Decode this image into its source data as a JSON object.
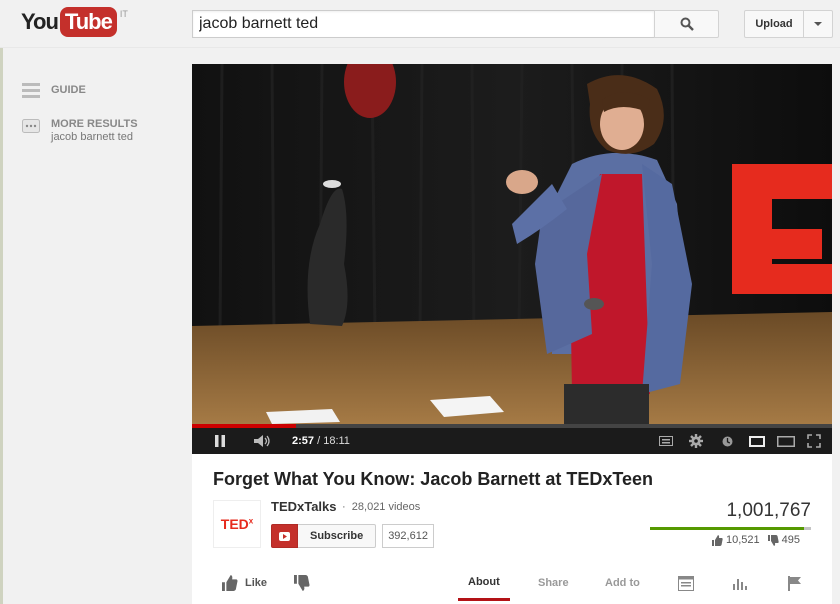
{
  "header": {
    "logo_you": "You",
    "logo_tube": "Tube",
    "region": "IT",
    "search_value": "jacob barnett ted",
    "upload_label": "Upload"
  },
  "guide": {
    "guide_label": "GUIDE",
    "more_results_label": "MORE RESULTS",
    "more_results_query": "jacob barnett ted"
  },
  "player": {
    "current_time": "2:57",
    "duration": "18:11",
    "progress_fraction": 0.162,
    "stage_letters": "TEE"
  },
  "video": {
    "title": "Forget What You Know: Jacob Barnett at TEDxTeen",
    "channel_name": "TEDxTalks",
    "video_count": "28,021 videos",
    "channel_logo": "TED",
    "channel_logo_sup": "x",
    "subscribe_label": "Subscribe",
    "subscriber_count": "392,612",
    "views": "1,001,767",
    "likes": "10,521",
    "dislikes": "495",
    "like_fraction": 0.955
  },
  "actions": {
    "like_label": "Like",
    "tabs": [
      "About",
      "Share",
      "Add to"
    ],
    "active_tab": "About"
  },
  "colors": {
    "brand_red": "#c4302b",
    "progress_red": "#cc0000",
    "like_green": "#559900"
  }
}
